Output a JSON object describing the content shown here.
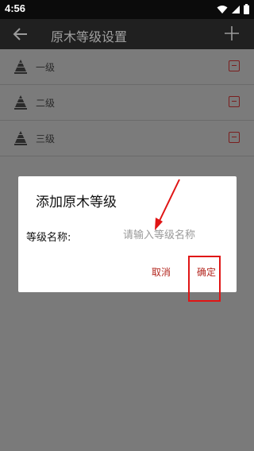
{
  "status_bar": {
    "time": "4:56",
    "icons": [
      "wifi-icon",
      "signal-icon",
      "battery-icon"
    ]
  },
  "toolbar": {
    "title": "原木等级设置",
    "back_icon": "arrow-back-icon",
    "add_icon": "plus-icon"
  },
  "grades": [
    {
      "label": "一级"
    },
    {
      "label": "二级"
    },
    {
      "label": "三级"
    }
  ],
  "dialog": {
    "title": "添加原木等级",
    "field_label": "等级名称:",
    "field_placeholder": "请输入等级名称",
    "field_value": "",
    "cancel_label": "取消",
    "confirm_label": "确定"
  },
  "colors": {
    "accent": "#b3261e",
    "annotation": "#e01515",
    "toolbar": "#202020"
  }
}
